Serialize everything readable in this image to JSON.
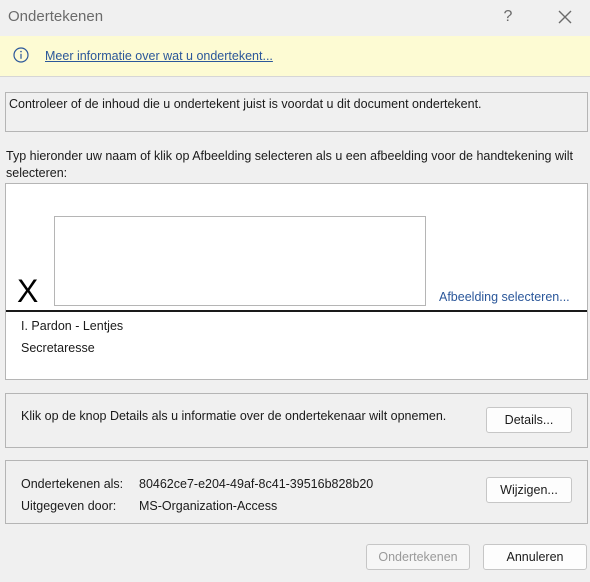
{
  "window": {
    "title": "Ondertekenen",
    "help": "?"
  },
  "infobar": {
    "link": "Meer informatie over wat u ondertekent..."
  },
  "notice": "Controleer of de inhoud die u ondertekent juist is voordat u dit document ondertekent.",
  "instruction": "Typ hieronder uw naam of klik op Afbeelding selecteren als u een afbeelding voor de handtekening wilt selecteren:",
  "signature": {
    "x_mark": "X",
    "input_value": "",
    "select_image_link": "Afbeelding selecteren...",
    "signer_name": "I. Pardon - Lentjes",
    "signer_title": "Secretaresse"
  },
  "details": {
    "text": "Klik op de knop Details als u informatie over de ondertekenaar wilt opnemen.",
    "button": "Details..."
  },
  "certificate": {
    "sign_as_label": "Ondertekenen als:",
    "sign_as_value": "80462ce7-e204-49af-8c41-39516b828b20",
    "issued_by_label": "Uitgegeven door:",
    "issued_by_value": "MS-Organization-Access",
    "change_button": "Wijzigen..."
  },
  "footer": {
    "sign_button": "Ondertekenen",
    "cancel_button": "Annuleren"
  },
  "colors": {
    "infobar_bg": "#fdfbd3",
    "link": "#2b579a",
    "disabled_text": "#9a9a9a"
  }
}
